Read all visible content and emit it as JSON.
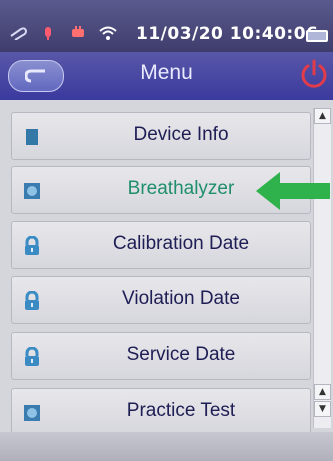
{
  "status_bar": {
    "time": "11/03/20 10:40:06"
  },
  "header": {
    "title": "Menu"
  },
  "menu": {
    "items": [
      {
        "label": "Device Info",
        "icon": "square-icon"
      },
      {
        "label": "Breathalyzer",
        "icon": "gauge-icon",
        "selected": true
      },
      {
        "label": "Calibration Date",
        "icon": "lock-icon"
      },
      {
        "label": "Violation Date",
        "icon": "lock-icon"
      },
      {
        "label": "Service Date",
        "icon": "lock-icon"
      },
      {
        "label": "Practice Test",
        "icon": "gauge-icon"
      }
    ]
  },
  "colors": {
    "header": "#3b3a9e",
    "selected_text": "#1f8f6b",
    "item_text": "#1e1e55",
    "arrow": "#2fb24c",
    "power": "#e23b4a"
  }
}
